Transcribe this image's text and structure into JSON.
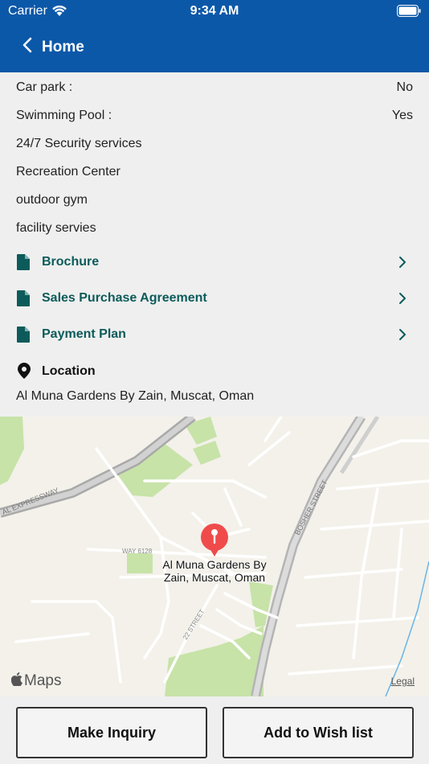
{
  "status": {
    "carrier": "Carrier",
    "time": "9:34 AM"
  },
  "nav": {
    "back_label": "Home"
  },
  "amenities": [
    {
      "label": "Car park :",
      "value": "No"
    },
    {
      "label": "Swimming Pool :",
      "value": "Yes"
    },
    {
      "label": "24/7 Security services"
    },
    {
      "label": "Recreation Center"
    },
    {
      "label": "outdoor gym"
    },
    {
      "label": "facility servies"
    }
  ],
  "documents": [
    {
      "label": "Brochure"
    },
    {
      "label": "Sales Purchase Agreement"
    },
    {
      "label": "Payment Plan"
    }
  ],
  "location": {
    "heading": "Location",
    "address": "Al Muna Gardens By Zain, Muscat, Oman"
  },
  "map": {
    "callout_line1": "Al Muna Gardens By",
    "callout_line2": "Zain, Muscat, Oman",
    "road_expressway": "AL EXPRESSWAY",
    "road_bosher": "BOSHER STREET",
    "road_way": "WAY 6128",
    "road_22": "22 STREET",
    "brand": "Maps",
    "legal": "Legal"
  },
  "actions": {
    "inquiry": "Make Inquiry",
    "wishlist": "Add to Wish list"
  },
  "colors": {
    "header": "#0c58a8",
    "doc_link": "#0c5b5a",
    "map_pin": "#f04b4b"
  }
}
